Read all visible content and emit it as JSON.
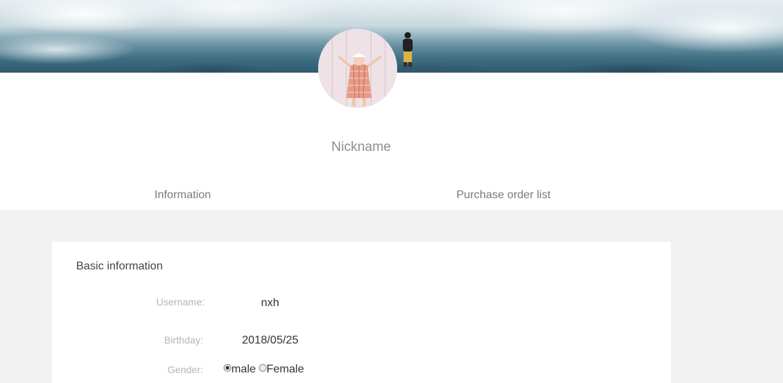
{
  "profile": {
    "nickname": "Nickname"
  },
  "tabs": [
    {
      "label": "Information"
    },
    {
      "label": "Purchase order list"
    }
  ],
  "basic_info": {
    "title": "Basic information",
    "username": {
      "label": "Username:",
      "value": "nxh"
    },
    "birthday": {
      "label": "Birthday:",
      "value": "2018/05/25"
    },
    "gender": {
      "label": "Gender:",
      "options": [
        {
          "label": "male",
          "checked": true
        },
        {
          "label": "Female",
          "checked": false
        }
      ]
    }
  }
}
